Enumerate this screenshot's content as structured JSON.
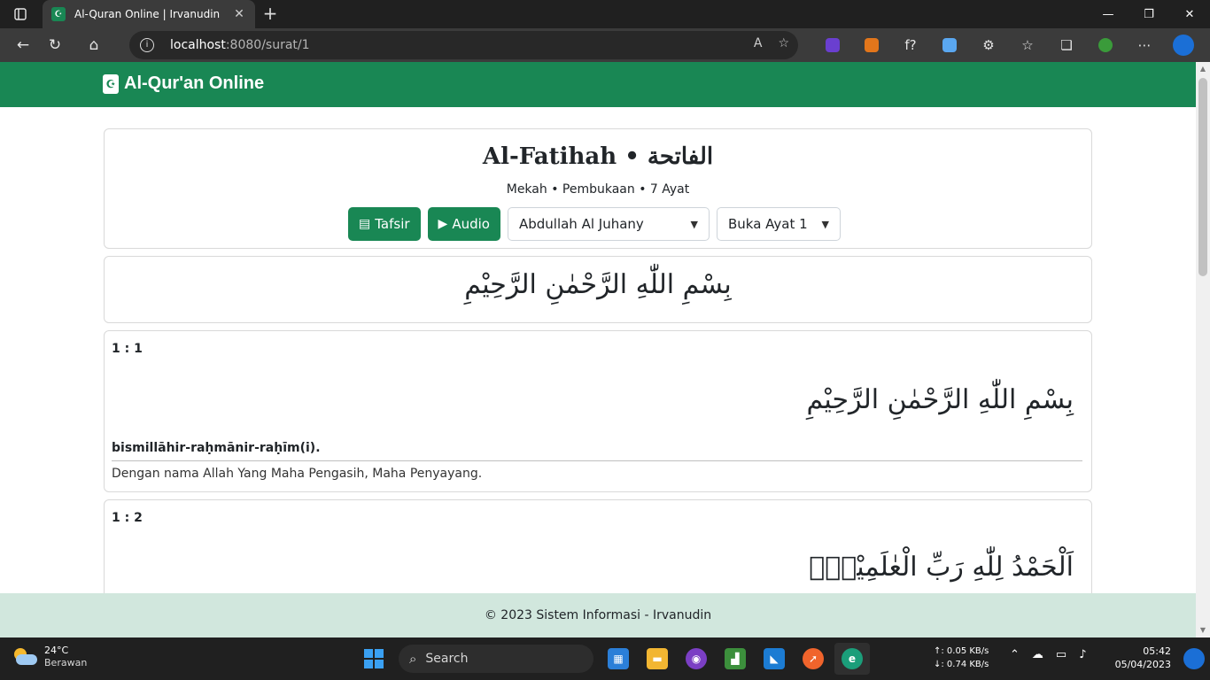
{
  "browser": {
    "tab_title": "Al-Quran Online | Irvanudin",
    "url_host": "localhost",
    "url_rest": ":8080/surat/1"
  },
  "site": {
    "brand": "Al-Qur'an Online"
  },
  "surah": {
    "title": "Al-Fatihah • الفاتحة",
    "info": "Mekah • Pembukaan • 7 Ayat",
    "tafsir_label": "Tafsir",
    "audio_label": "Audio",
    "reciter_selected": "Abdullah Al Juhany",
    "ayat_jump_selected": "Buka Ayat 1",
    "bismillah": "بِسْمِ اللّٰهِ الرَّحْمٰنِ الرَّحِيْمِ"
  },
  "ayat": [
    {
      "number": "1 : 1",
      "arabic": "بِسْمِ اللّٰهِ الرَّحْمٰنِ الرَّحِيْمِ",
      "latin": "bismillāhir-raḥmānir-raḥīm(i).",
      "translation": "Dengan nama Allah Yang Maha Pengasih, Maha Penyayang."
    },
    {
      "number": "1 : 2",
      "arabic": "اَلْحَمْدُ لِلّٰهِ رَبِّ الْعٰلَمِيْنَۙ"
    }
  ],
  "footer": {
    "text": "© 2023 Sistem Informasi - Irvanudin"
  },
  "taskbar": {
    "weather_temp": "24°C",
    "weather_desc": "Berawan",
    "search_label": "Search",
    "net_up": "↑: 0.05 KB/s",
    "net_down": "↓: 0.74 KB/s",
    "time": "05:42",
    "date": "05/04/2023"
  },
  "icons": {
    "tafsir": "book-icon",
    "audio": "play-icon"
  },
  "colors": {
    "primary": "#198754",
    "footer_bg": "#d1e7dd"
  }
}
